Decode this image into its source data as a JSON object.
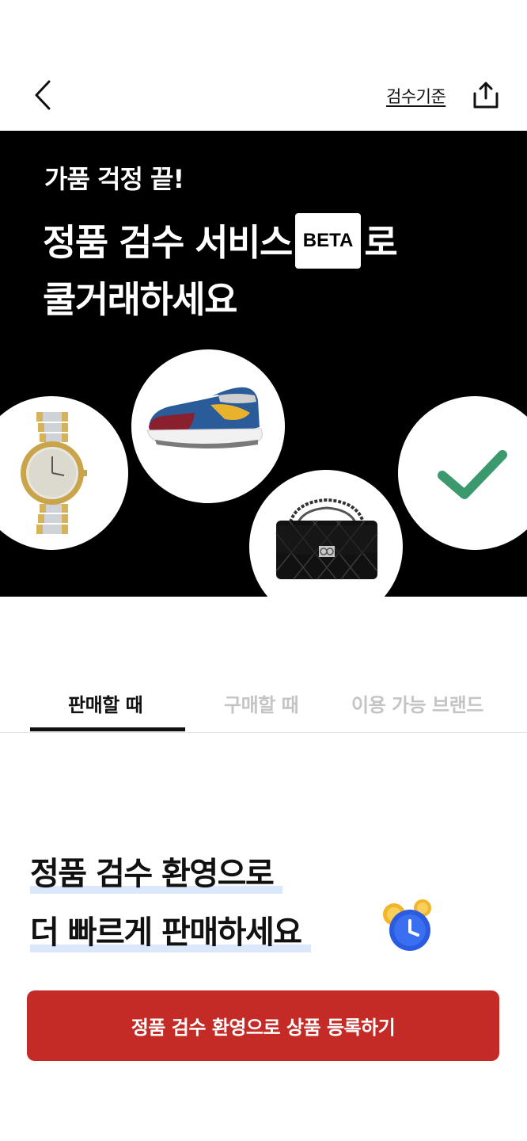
{
  "header": {
    "criteria_link": "검수기준"
  },
  "hero": {
    "subtitle": "가품 걱정 끝!",
    "title_line1_before": "정품 검수 서비스",
    "beta_badge": "BETA",
    "title_line1_after": "로",
    "title_line2": "쿨거래하세요",
    "items": [
      "watch",
      "sneaker",
      "handbag",
      "check"
    ],
    "check_color": "#3a9a6e"
  },
  "tabs": [
    {
      "label": "판매할 때",
      "active": true
    },
    {
      "label": "구매할 때",
      "active": false
    },
    {
      "label": "이용 가능 브랜드",
      "active": false
    }
  ],
  "content": {
    "headline_line1": "정품 검수 환영으로",
    "headline_line2": "더 빠르게 판매하세요",
    "icon": "alarm-clock-icon"
  },
  "cta": {
    "label": "정품 검수 환영으로 상품 등록하기",
    "color": "#c52b26"
  },
  "colors": {
    "highlight": "#dbe8fb",
    "hero_bg": "#000000"
  }
}
